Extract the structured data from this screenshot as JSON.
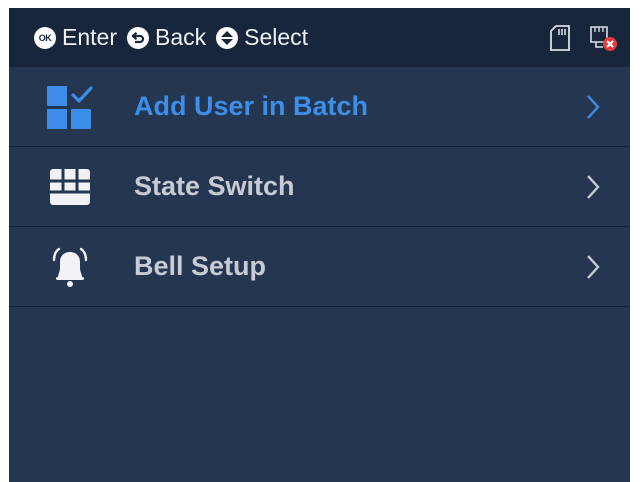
{
  "header": {
    "hints": [
      {
        "key": "OK",
        "icon": "ok-button-icon",
        "label": "Enter"
      },
      {
        "icon": "back-arrow-icon",
        "label": "Back"
      },
      {
        "icon": "up-down-arrows-icon",
        "label": "Select"
      }
    ],
    "status_icons": [
      "sd-card-icon",
      "network-disconnected-icon"
    ]
  },
  "menu": {
    "items": [
      {
        "label": "Add User in Batch",
        "icon": "batch-add-icon",
        "selected": true
      },
      {
        "label": "State Switch",
        "icon": "keypad-grid-icon",
        "selected": false
      },
      {
        "label": "Bell Setup",
        "icon": "bell-icon",
        "selected": false
      }
    ]
  },
  "colors": {
    "header_bg": "#17263b",
    "panel_bg": "#243650",
    "accent": "#3d8ee8",
    "text": "#c7ccd4",
    "alert": "#e23b3b"
  }
}
